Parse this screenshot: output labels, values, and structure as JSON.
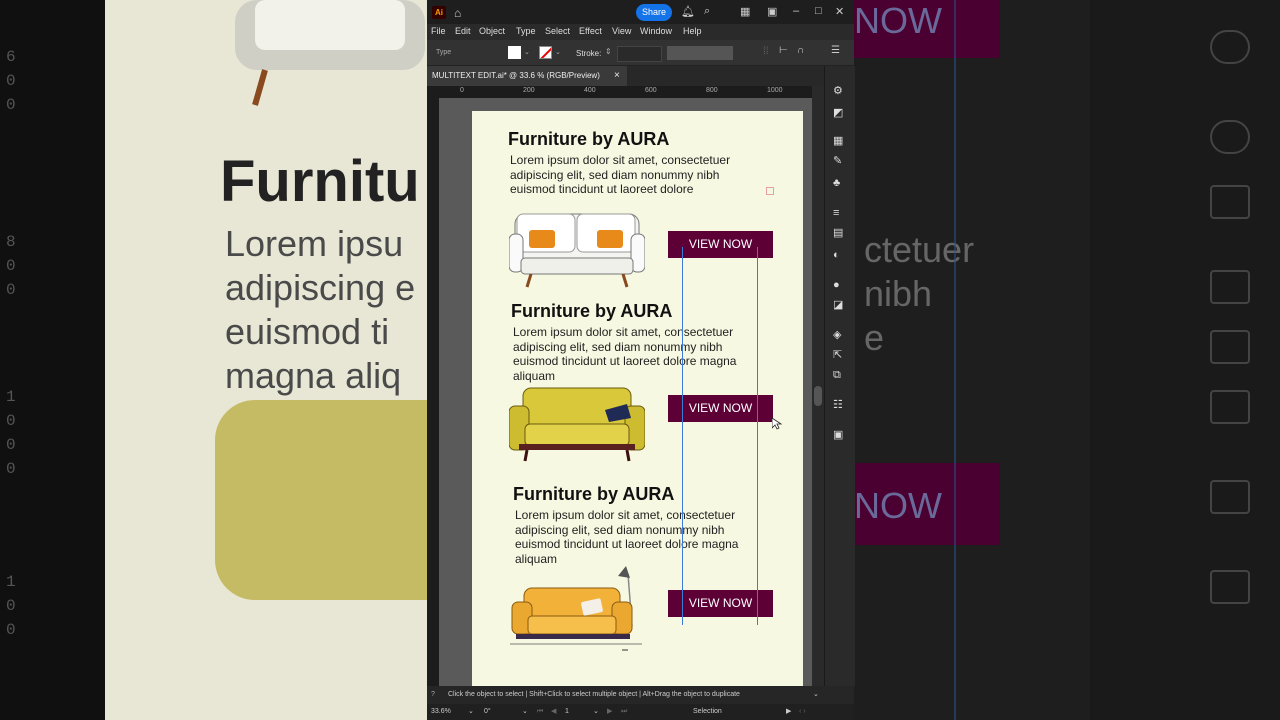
{
  "background": {
    "left_heading": "Furnitu",
    "left_text_lines": [
      "Lorem ipsu",
      "adipiscing e",
      "euismod ti",
      "magna aliq"
    ],
    "right_text_lines": [
      "ctetuer",
      "nibh",
      "e"
    ],
    "right_now_labels": [
      "NOW",
      "NOW"
    ],
    "left_digits": [
      "6",
      "0",
      "0",
      "8",
      "0",
      "0",
      "1",
      "0",
      "0",
      "0",
      "1",
      "0",
      "0"
    ]
  },
  "app": {
    "logo": "Ai",
    "share_label": "Share",
    "menu": [
      "File",
      "Edit",
      "Object",
      "Type",
      "Select",
      "Effect",
      "View",
      "Window",
      "Help"
    ],
    "control_bar": {
      "type_label": "Type",
      "stroke_label": "Stroke:"
    },
    "doc_tab": {
      "title": "MULTITEXT EDIT.ai* @ 33.6 % (RGB/Preview)",
      "close": "×"
    },
    "ruler_marks": [
      "0",
      "200",
      "400",
      "600",
      "800",
      "1000"
    ],
    "status_text": "Click the object to select  |  Shift+Click to select multiple object  |  Alt+Drag the object to duplicate",
    "zoom": "33.6%",
    "rotation": "0°",
    "artboard_index": "1",
    "tool_state": "Selection"
  },
  "artboard": {
    "sections": [
      {
        "title": "Furniture by AURA",
        "body": "Lorem ipsum dolor sit amet, consectetuer adipiscing elit, sed diam nonummy nibh euismod tincidunt ut laoreet dolore",
        "button": "VIEW NOW",
        "sofa": "white-sofa"
      },
      {
        "title": "Furniture by AURA",
        "body": "Lorem ipsum dolor sit amet, consectetuer adipiscing elit, sed diam nonummy nibh euismod tincidunt ut laoreet dolore magna aliquam",
        "button": "VIEW NOW",
        "sofa": "yellow-sofa"
      },
      {
        "title": "Furniture by AURA",
        "body": "Lorem ipsum dolor sit amet, consectetuer adipiscing elit, sed diam nonummy nibh euismod tincidunt ut laoreet dolore magna aliquam",
        "button": "VIEW NOW",
        "sofa": "orange-sofa"
      }
    ]
  },
  "colors": {
    "button": "#5c0036",
    "artboard": "#f7f8e1",
    "selection": "#3c7bd6",
    "share": "#1473e6"
  }
}
